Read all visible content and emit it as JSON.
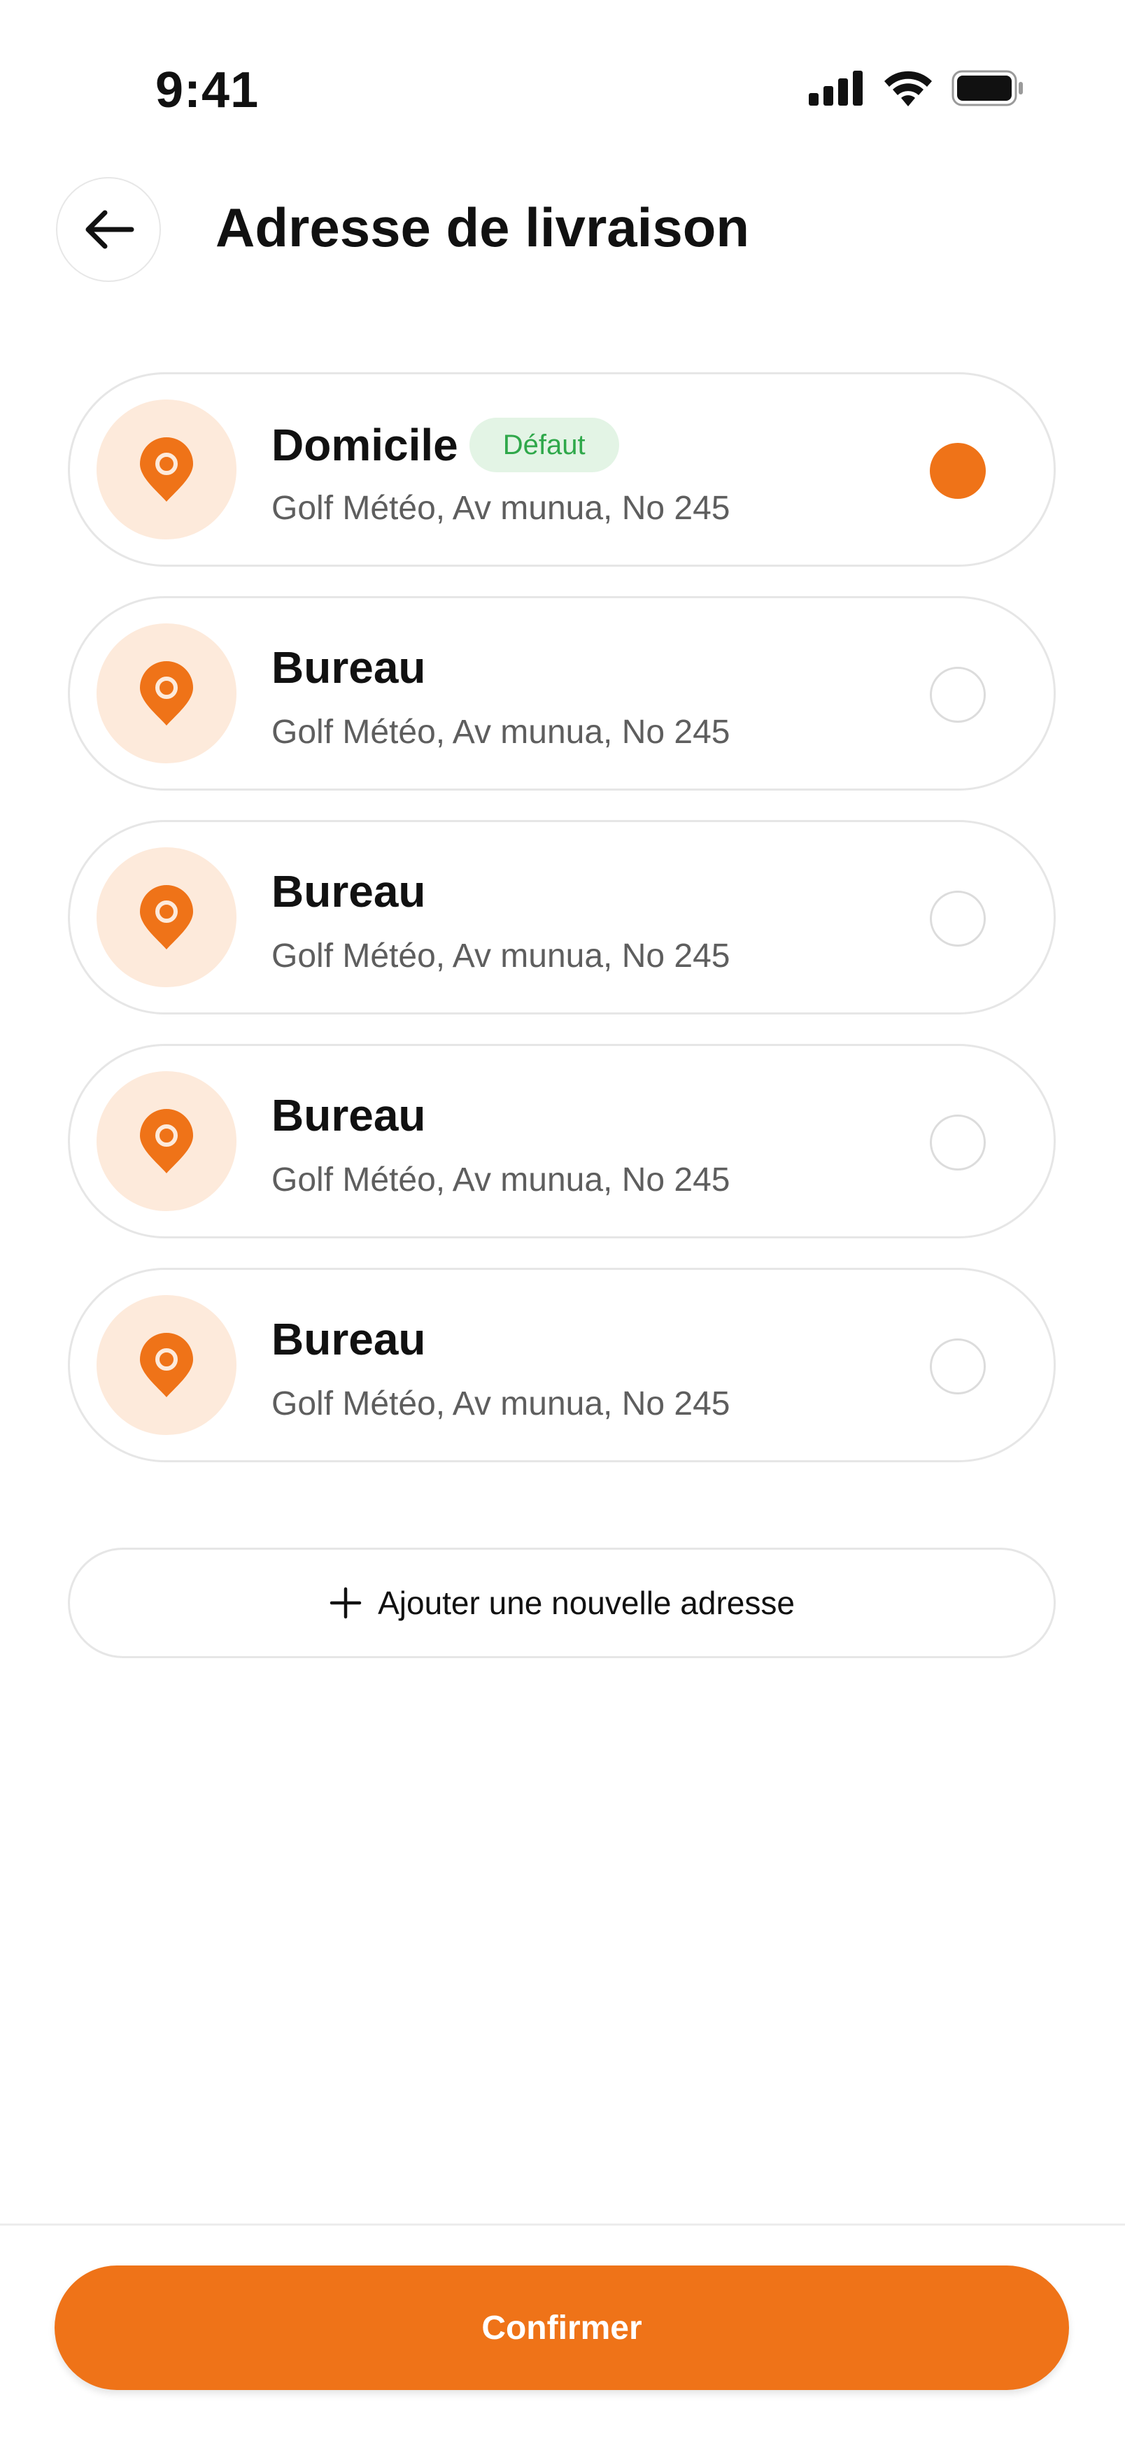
{
  "status_bar": {
    "time": "9:41"
  },
  "header": {
    "title": "Adresse de livraison"
  },
  "addresses": [
    {
      "title": "Domicile",
      "badge": "Défaut",
      "address": "Golf Météo, Av munua, No 245",
      "selected": true
    },
    {
      "title": "Bureau",
      "address": "Golf Météo, Av munua, No 245",
      "selected": false
    },
    {
      "title": "Bureau",
      "address": "Golf Météo, Av munua, No 245",
      "selected": false
    },
    {
      "title": "Bureau",
      "address": "Golf Météo, Av munua, No 245",
      "selected": false
    },
    {
      "title": "Bureau",
      "address": "Golf Météo, Av munua, No 245",
      "selected": false
    }
  ],
  "add_address": {
    "label": "Ajouter une nouvelle adresse",
    "icon": "plus-icon"
  },
  "confirm": {
    "label": "Confirmer"
  },
  "colors": {
    "accent": "#EF7318",
    "pin_background": "#FDEADB",
    "badge_background": "#E3F4E5",
    "badge_text": "#2FA84A"
  }
}
